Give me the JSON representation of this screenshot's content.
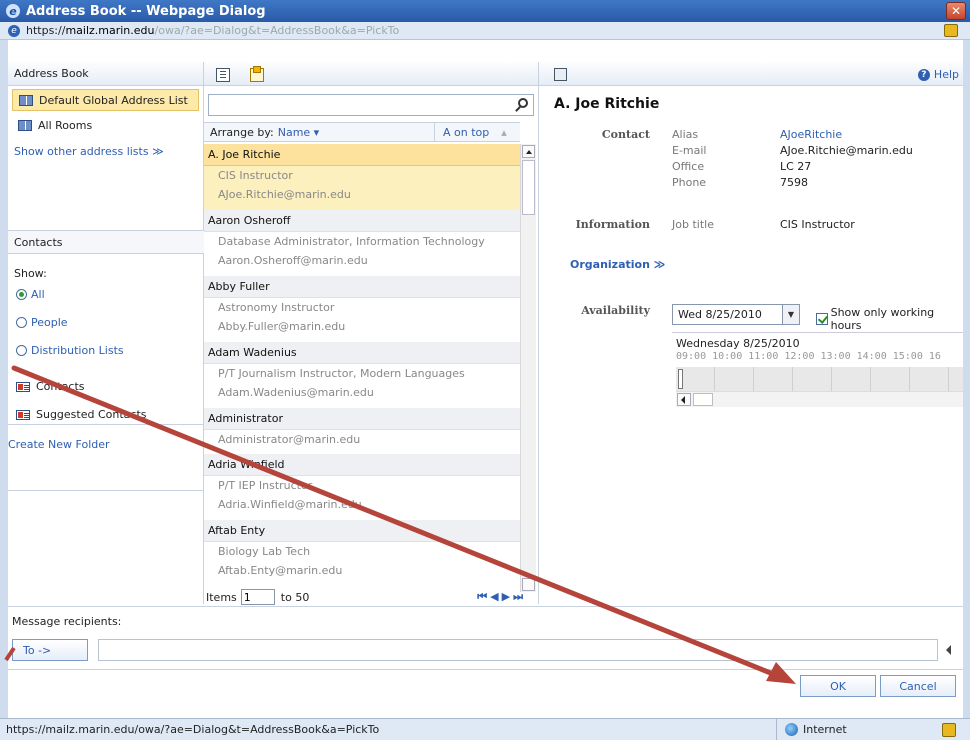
{
  "window": {
    "title": "Address Book -- Webpage Dialog"
  },
  "url": {
    "scheme": "https://",
    "domain": "mailz.marin.edu",
    "path": "/owa/?ae=Dialog&t=AddressBook&a=PickTo"
  },
  "left": {
    "header": "Address Book",
    "lists": [
      "Default Global Address List",
      "All Rooms"
    ],
    "show_other": "Show other address lists ≫",
    "contacts_header": "Contacts",
    "show_label": "Show:",
    "filters": [
      "All",
      "People",
      "Distribution Lists"
    ],
    "folders": [
      "Contacts",
      "Suggested Contacts"
    ],
    "create_folder": "Create New Folder"
  },
  "middle": {
    "search_placeholder": "",
    "arrange_label": "Arrange by:",
    "arrange_value": "Name ▾",
    "sort_label": "A on top",
    "sort_arrow": "▴",
    "items": [
      {
        "name": "A. Joe Ritchie",
        "line1": "CIS Instructor",
        "line2": "AJoe.Ritchie@marin.edu"
      },
      {
        "name": "Aaron Osheroff",
        "line1": "Database Administrator, Information Technology",
        "line2": "Aaron.Osheroff@marin.edu"
      },
      {
        "name": "Abby Fuller",
        "line1": "Astronomy Instructor",
        "line2": "Abby.Fuller@marin.edu"
      },
      {
        "name": "Adam Wadenius",
        "line1": "P/T Journalism Instructor, Modern Languages",
        "line2": "Adam.Wadenius@marin.edu"
      },
      {
        "name": "Administrator",
        "line1": "Administrator@marin.edu",
        "line2": ""
      },
      {
        "name": "Adria Winfield",
        "line1": "P/T IEP Instructor",
        "line2": "Adria.Winfield@marin.edu"
      },
      {
        "name": "Aftab Enty",
        "line1": "Biology Lab Tech",
        "line2": "Aftab.Enty@marin.edu"
      }
    ],
    "pager": {
      "label": "Items",
      "value": "1",
      "range": "to 50",
      "nav": "⏮◀▶⏭"
    }
  },
  "detail": {
    "help": "Help",
    "name": "A. Joe Ritchie",
    "contact_label": "Contact",
    "fields": [
      {
        "label": "Alias",
        "value": "AJoeRitchie"
      },
      {
        "label": "E-mail",
        "value": "AJoe.Ritchie@marin.edu"
      },
      {
        "label": "Office",
        "value": "LC 27"
      },
      {
        "label": "Phone",
        "value": "7598"
      }
    ],
    "information_label": "Information",
    "job_title_label": "Job title",
    "job_title_value": "CIS Instructor",
    "organization": "Organization ≫",
    "availability_label": "Availability",
    "date_value": "Wed 8/25/2010",
    "working_hours": "Show only working hours",
    "day_label": "Wednesday 8/25/2010",
    "hours": "09:00  10:00  11:00  12:00  13:00  14:00  15:00  16"
  },
  "recipients": {
    "label": "Message recipients:",
    "to_button": "To ->",
    "ok": "OK",
    "cancel": "Cancel"
  },
  "status": {
    "url": "https://mailz.marin.edu/owa/?ae=Dialog&t=AddressBook&a=PickTo",
    "zone": "Internet"
  },
  "colors": {
    "arrow": "#b5443b",
    "accent": "#2e5fb0",
    "selected": "#fce29d"
  }
}
